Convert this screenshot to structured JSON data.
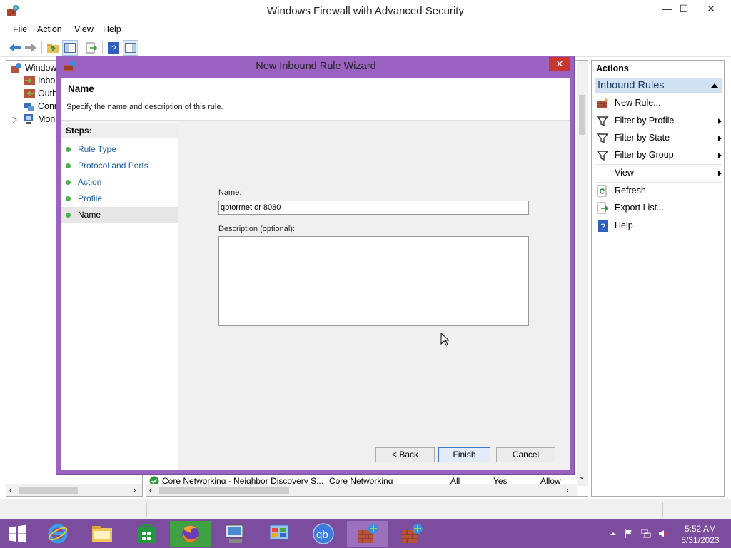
{
  "app": {
    "title": "Windows Firewall with Advanced Security",
    "window_controls": {
      "minimize": "—",
      "maximize": "☐",
      "close": "✕"
    }
  },
  "menubar": [
    "File",
    "Action",
    "View",
    "Help"
  ],
  "tree": {
    "items": [
      "Window",
      "Inbo",
      "Outb",
      "Conn",
      "Mon"
    ]
  },
  "center": {
    "row": {
      "name": "Core Networking - Neighbor Discovery S...",
      "group": "Core Networking",
      "profile": "All",
      "enabled": "Yes",
      "action": "Allow"
    }
  },
  "actions": {
    "header": "Actions",
    "section": "Inbound Rules",
    "items": [
      {
        "label": "New Rule...",
        "icon": "new-rule-icon",
        "submenu": false
      },
      {
        "label": "Filter by Profile",
        "icon": "filter-icon",
        "submenu": true
      },
      {
        "label": "Filter by State",
        "icon": "filter-icon",
        "submenu": true
      },
      {
        "label": "Filter by Group",
        "icon": "filter-icon",
        "submenu": true
      },
      {
        "label": "View",
        "icon": "",
        "submenu": true
      },
      {
        "label": "Refresh",
        "icon": "refresh-icon",
        "submenu": false
      },
      {
        "label": "Export List...",
        "icon": "export-icon",
        "submenu": false
      },
      {
        "label": "Help",
        "icon": "help-icon",
        "submenu": false
      }
    ]
  },
  "dialog": {
    "title": "New Inbound Rule Wizard",
    "close": "✕",
    "page_title": "Name",
    "page_subtitle": "Specify the name and description of this rule.",
    "steps_header": "Steps:",
    "steps": [
      "Rule Type",
      "Protocol and Ports",
      "Action",
      "Profile",
      "Name"
    ],
    "current_step": 4,
    "name_label": "Name:",
    "name_value": "qbtorrnet or 8080",
    "desc_label": "Description (optional):",
    "desc_value": "",
    "buttons": {
      "back": "< Back",
      "finish": "Finish",
      "cancel": "Cancel"
    }
  },
  "taskbar": {
    "time": "5:52 AM",
    "date": "5/31/2023",
    "apps": [
      "start",
      "internet-explorer",
      "file-explorer",
      "store",
      "firefox",
      "remote-desktop",
      "control-panel",
      "qbittorrent",
      "firewall",
      "firewall"
    ],
    "active_index": 8
  },
  "colors": {
    "accent": "#7c4c9f",
    "dialog_frame": "#9a63c1",
    "close_red": "#c7372f",
    "link_blue": "#1e5ea8"
  }
}
